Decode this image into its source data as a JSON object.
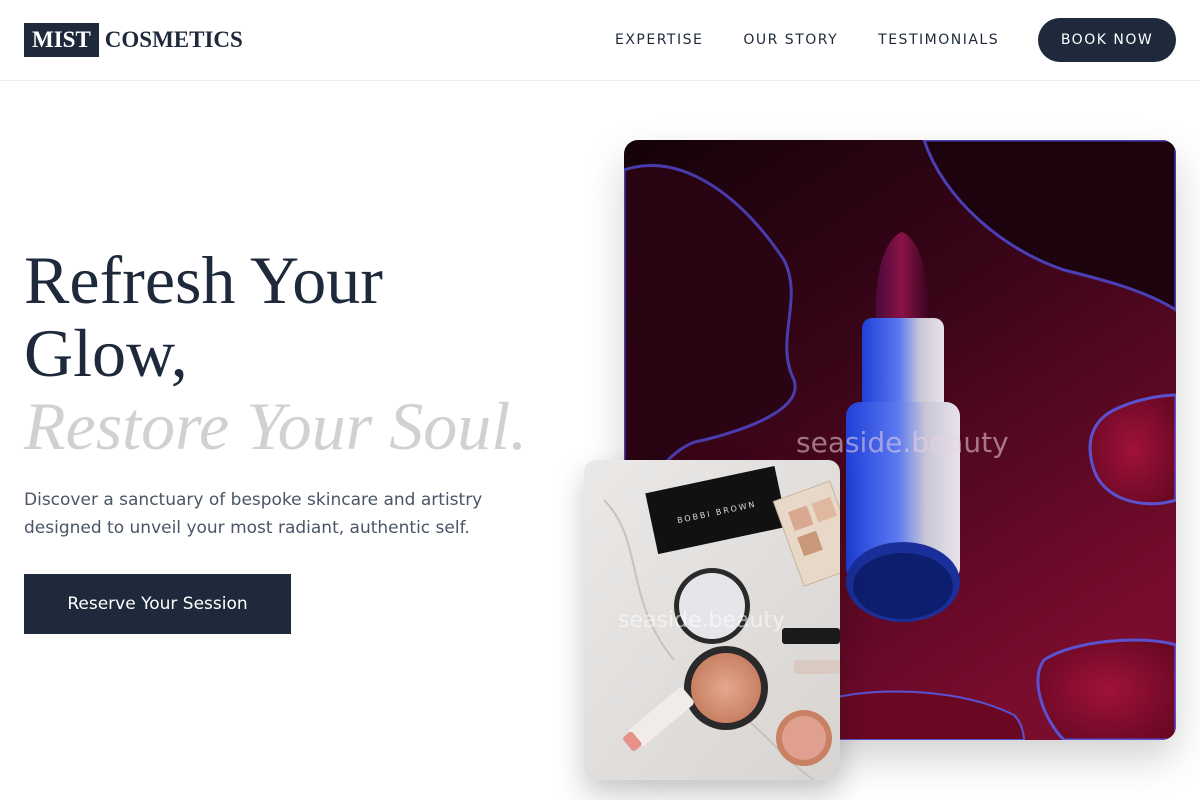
{
  "brand": {
    "logo_box": "MIST",
    "logo_rest": "COSMETICS"
  },
  "nav": {
    "items": [
      {
        "label": "EXPERTISE"
      },
      {
        "label": "OUR STORY"
      },
      {
        "label": "TESTIMONIALS"
      }
    ],
    "book_label": "BOOK NOW"
  },
  "hero": {
    "title_line1": "Refresh Your",
    "title_line2": "Glow,",
    "title_accent": "Restore Your Soul.",
    "description": "Discover a sanctuary of bespoke skincare and artistry designed to unveil your most radiant, authentic self.",
    "cta_label": "Reserve Your Session"
  },
  "images": {
    "main_watermark": "seaside.beauty",
    "sub_watermark": "seaside.beauty"
  },
  "colors": {
    "primary": "#1e2a3b",
    "accent_text": "#d1d1d1",
    "body_text": "#4a5568"
  }
}
